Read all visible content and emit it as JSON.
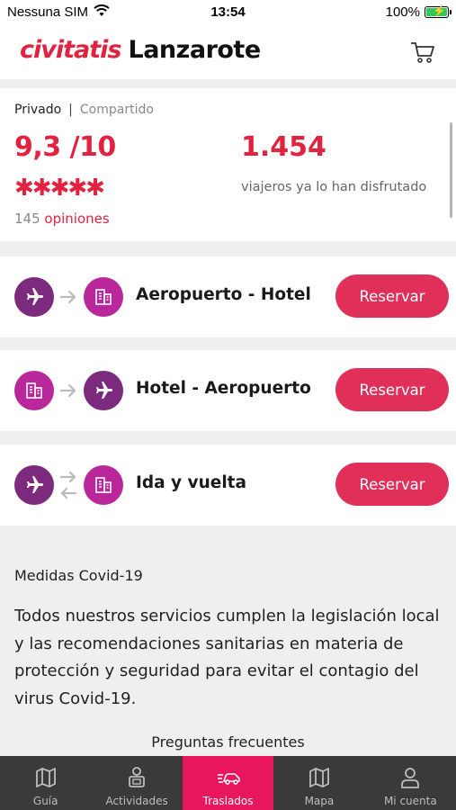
{
  "status_bar": {
    "carrier": "Nessuna SIM",
    "time": "13:54",
    "battery": "100%"
  },
  "header": {
    "brand": "civitatis",
    "destination": "Lanzarote"
  },
  "rating": {
    "type_active": "Privado",
    "type_separator": "|",
    "type_inactive": "Compartido",
    "score": "9,3 /10",
    "stars": "✱✱✱✱✱",
    "reviews_count": "145",
    "reviews_label": "opiniones",
    "travelers_count": "1.454",
    "travelers_label": "viajeros ya lo han disfrutado"
  },
  "transfers": [
    {
      "label": "Aeropuerto - Hotel",
      "button": "Reservar"
    },
    {
      "label": "Hotel - Aeropuerto",
      "button": "Reservar"
    },
    {
      "label": "Ida y vuelta",
      "button": "Reservar"
    }
  ],
  "covid": {
    "title": "Medidas Covid-19",
    "text": "Todos nuestros servicios cumplen la legislación local y las recomendaciones sanitarias en materia de protección y seguridad para evitar el contagio del virus Covid-19."
  },
  "faq_label": "Preguntas frecuentes",
  "tabs": [
    {
      "label": "Guía",
      "icon": "guide-map-icon"
    },
    {
      "label": "Actividades",
      "icon": "activities-icon"
    },
    {
      "label": "Traslados",
      "icon": "transfer-car-icon",
      "active": true
    },
    {
      "label": "Mapa",
      "icon": "map-icon"
    },
    {
      "label": "Mi cuenta",
      "icon": "account-icon"
    }
  ],
  "colors": {
    "brand": "#e2233f",
    "button": "#e0305a",
    "plane_circle": "#7b2a7e",
    "hotel_circle": "#b9279b",
    "tab_active": "#e8175d",
    "tab_bar": "#3a3a3a"
  }
}
